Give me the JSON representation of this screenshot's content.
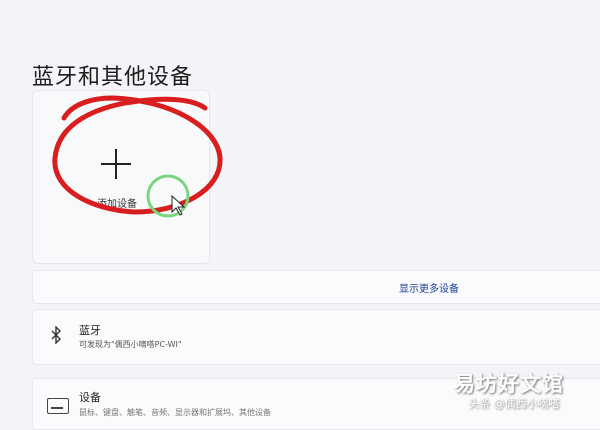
{
  "page": {
    "title": "蓝牙和其他设备"
  },
  "add_device": {
    "label": "添加设备",
    "icon": "plus-icon"
  },
  "more_devices": {
    "label": "显示更多设备"
  },
  "bluetooth": {
    "title": "蓝牙",
    "subtitle": "可发现为\"偶西小嘀嗒PC-WI\"",
    "icon": "bluetooth-icon"
  },
  "devices": {
    "title": "设备",
    "subtitle": "鼠标、键盘、触笔、音频、显示器和扩展坞、其他设备",
    "icon": "keyboard-icon"
  },
  "annotation": {
    "circle_color": "#d81e1e",
    "cursor_highlight_color": "#7ad67e"
  },
  "overlay": {
    "watermark": "易坊好文馆",
    "credit": "头条 @偶西小嘀嗒"
  }
}
